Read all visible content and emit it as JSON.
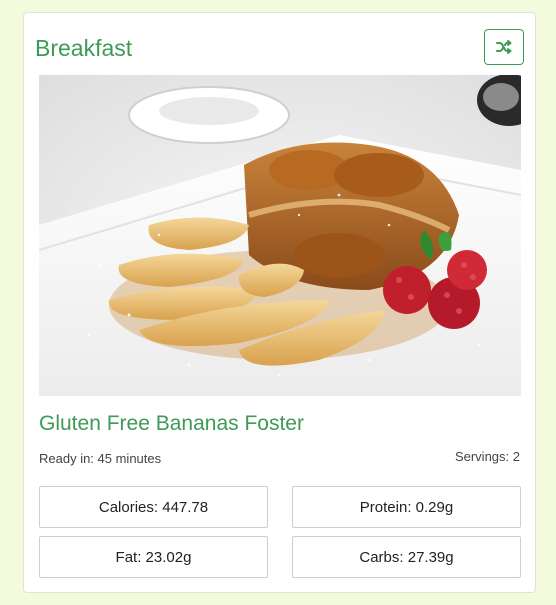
{
  "card": {
    "title": "Breakfast",
    "shuffle_icon": "shuffle-icon",
    "accent_color": "#3e9b55"
  },
  "recipe": {
    "name": "Gluten Free Bananas Foster",
    "ready_in": "Ready in: 45 minutes",
    "servings": "Servings: 2",
    "image_icon": "food-photo"
  },
  "nutrition": {
    "calories": "Calories: 447.78",
    "protein": "Protein: 0.29g",
    "fat": "Fat: 23.02g",
    "carbs": "Carbs: 27.39g"
  }
}
